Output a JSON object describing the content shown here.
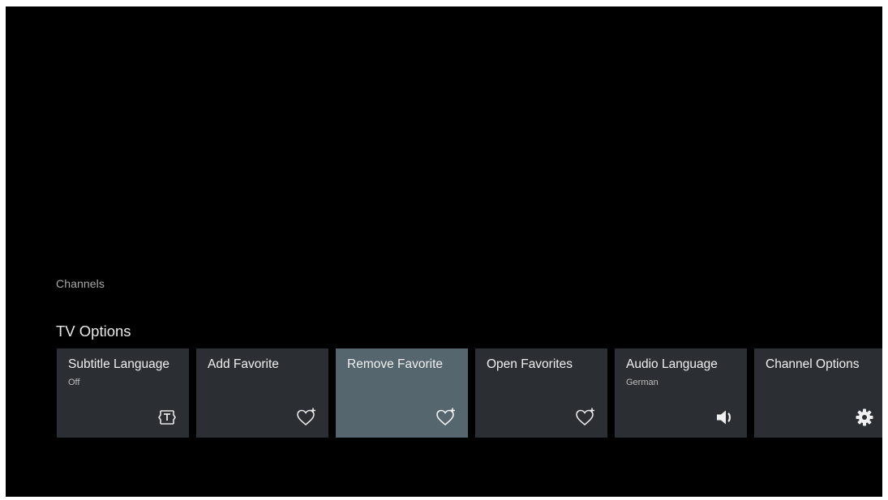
{
  "section": {
    "label": "Channels"
  },
  "row": {
    "title": "TV Options"
  },
  "cards": [
    {
      "title": "Subtitle Language",
      "subtitle": "Off",
      "icon": "subtitle-icon",
      "focused": false
    },
    {
      "title": "Add Favorite",
      "subtitle": "",
      "icon": "heart-plus-icon",
      "focused": false
    },
    {
      "title": "Remove Favorite",
      "subtitle": "",
      "icon": "heart-plus-icon",
      "focused": true
    },
    {
      "title": "Open Favorites",
      "subtitle": "",
      "icon": "heart-plus-icon",
      "focused": false
    },
    {
      "title": "Audio Language",
      "subtitle": "German",
      "icon": "speaker-icon",
      "focused": false
    },
    {
      "title": "Channel Options",
      "subtitle": "",
      "icon": "gear-icon",
      "focused": false
    }
  ],
  "colors": {
    "background": "#000000",
    "card": "#2b2f33",
    "card_focused": "#56666e",
    "text": "#f0f0f0",
    "subtext": "#bdbdbd"
  }
}
